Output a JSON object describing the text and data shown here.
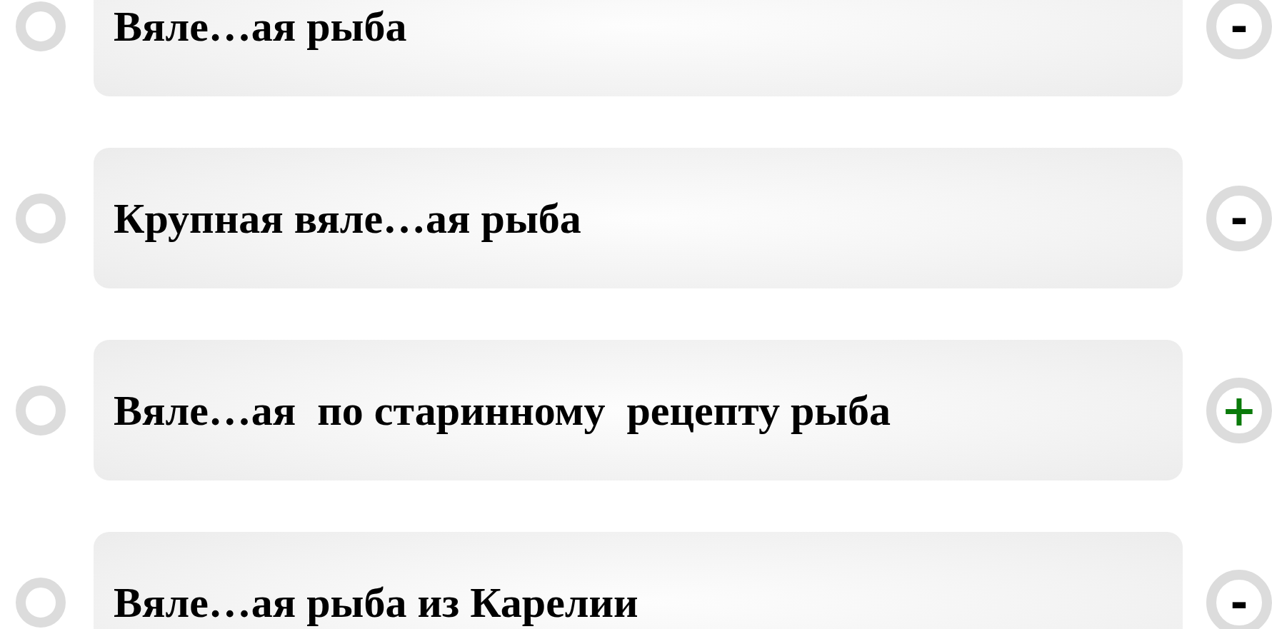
{
  "options": [
    {
      "text": "Вяле…ая рыба",
      "selected": false,
      "mark": "-",
      "correct": false
    },
    {
      "text": "Крупная вяле…ая рыба",
      "selected": false,
      "mark": "-",
      "correct": false
    },
    {
      "text": "Вяле…ая  по старинному  рецепту рыба",
      "selected": false,
      "mark": "+",
      "correct": true
    },
    {
      "text": "Вяле…ая рыба из Карелии",
      "selected": false,
      "mark": "-",
      "correct": false
    }
  ]
}
